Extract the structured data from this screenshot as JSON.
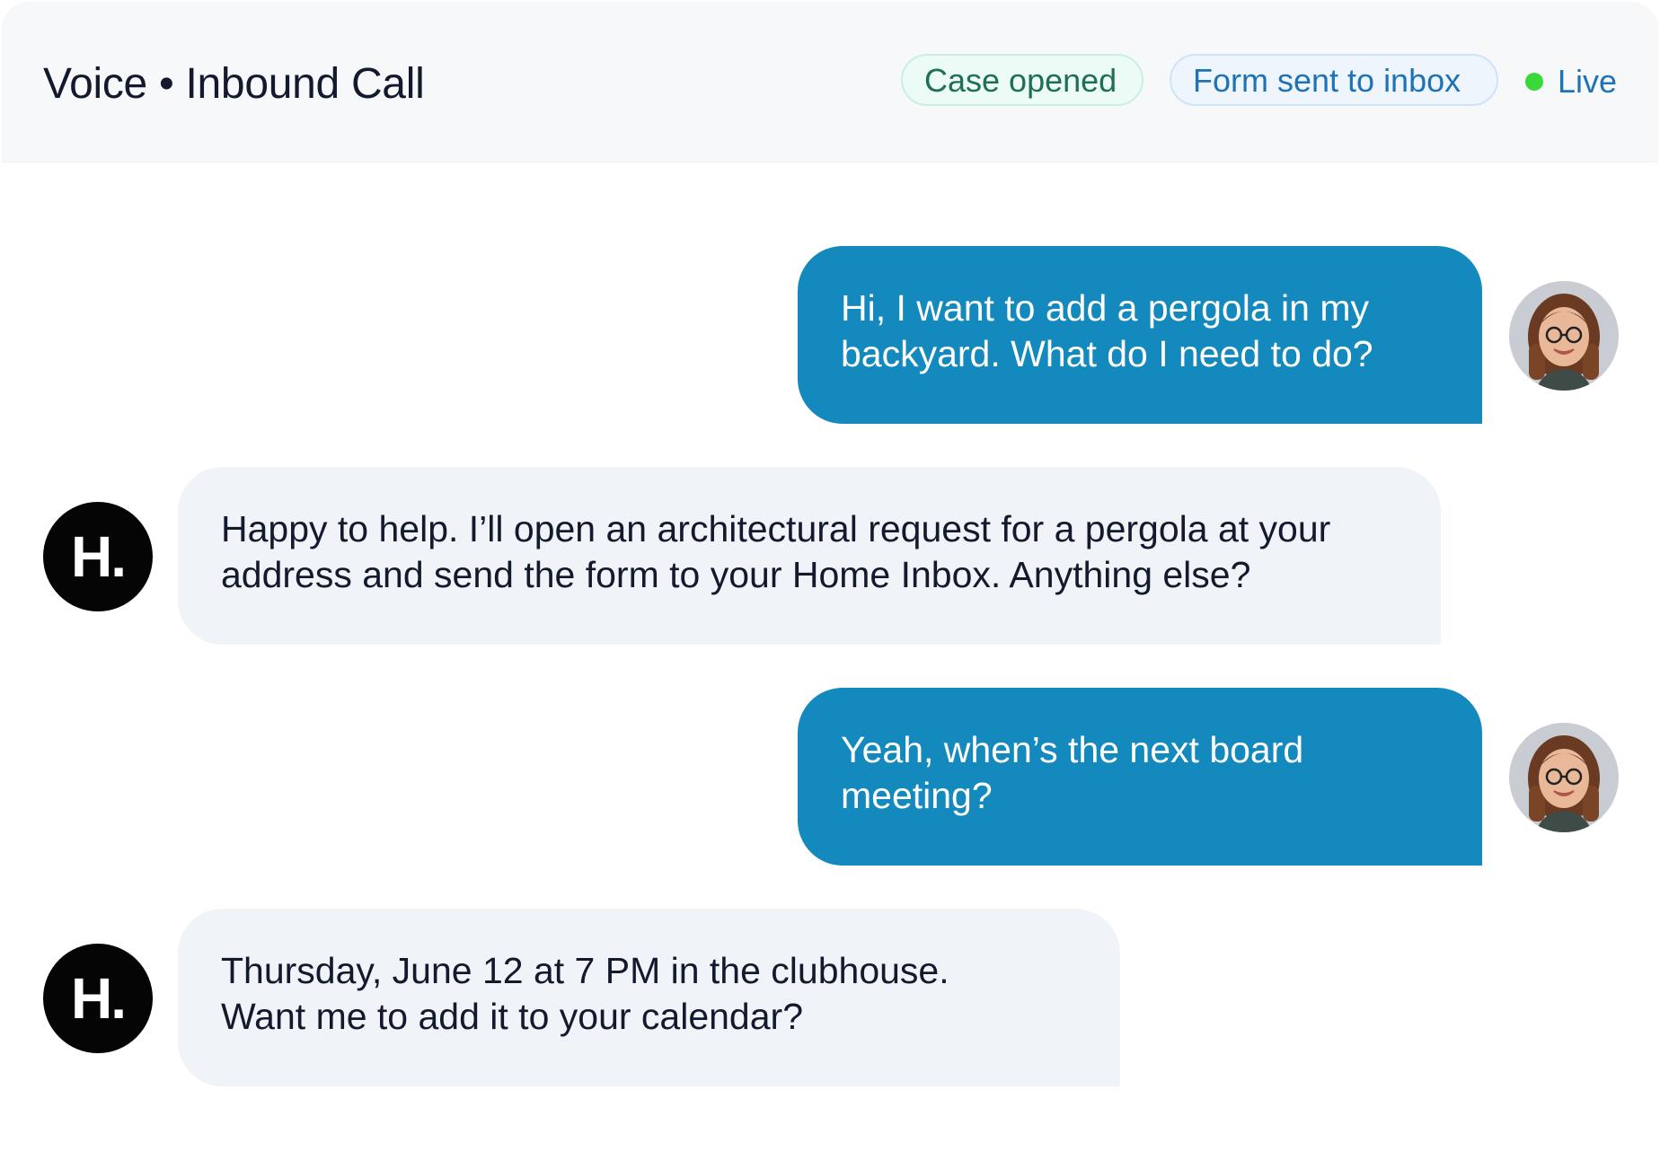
{
  "header": {
    "title": "Voice • Inbound Call",
    "badges": {
      "case": "Case opened",
      "form": "Form sent to inbox"
    },
    "status": "Live"
  },
  "colors": {
    "user_bubble": "#1489bd",
    "agent_bubble": "#f0f3f7",
    "live_dot": "#39d93a",
    "agent_avatar": "#050505"
  },
  "agent": {
    "avatar_text": "H."
  },
  "messages": [
    {
      "sender": "user",
      "lines": [
        "Hi, I want to add a pergola in my",
        "backyard. What do I need to do?"
      ]
    },
    {
      "sender": "agent",
      "lines": [
        "Happy to help. I’ll open an architectural request for a pergola at your",
        "address and send the form to your Home Inbox. Anything else?"
      ]
    },
    {
      "sender": "user",
      "lines": [
        "Yeah, when’s the next board",
        "meeting?"
      ]
    },
    {
      "sender": "agent",
      "lines": [
        "Thursday, June 12 at 7 PM in the clubhouse.",
        "Want me to add it to your calendar?"
      ]
    }
  ]
}
